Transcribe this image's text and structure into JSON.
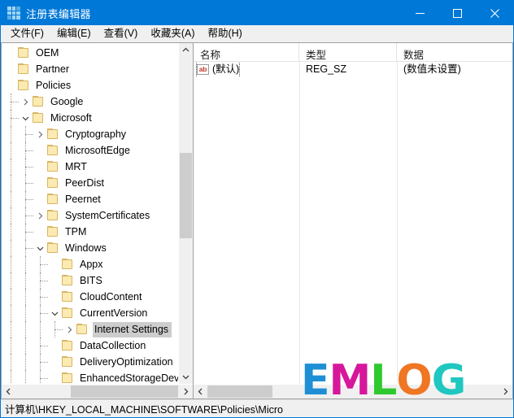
{
  "window": {
    "title": "注册表编辑器",
    "icon": "registry-grid-icon",
    "accent_color": "#0078d7",
    "controls": {
      "minimize": "最小化",
      "maximize": "最大化",
      "close": "关闭"
    }
  },
  "menu": {
    "items": [
      {
        "label": "文件(F)",
        "name": "menu-file"
      },
      {
        "label": "编辑(E)",
        "name": "menu-edit"
      },
      {
        "label": "查看(V)",
        "name": "menu-view"
      },
      {
        "label": "收藏夹(A)",
        "name": "menu-favorites"
      },
      {
        "label": "帮助(H)",
        "name": "menu-help"
      }
    ]
  },
  "tree": {
    "items": [
      {
        "label": "OEM",
        "depth": 0,
        "twisty": "none",
        "selected": false
      },
      {
        "label": "Partner",
        "depth": 0,
        "twisty": "none",
        "selected": false
      },
      {
        "label": "Policies",
        "depth": 0,
        "twisty": "none",
        "selected": false
      },
      {
        "label": "Google",
        "depth": 1,
        "twisty": "collapsed",
        "selected": false
      },
      {
        "label": "Microsoft",
        "depth": 1,
        "twisty": "expanded",
        "selected": false
      },
      {
        "label": "Cryptography",
        "depth": 2,
        "twisty": "collapsed",
        "selected": false
      },
      {
        "label": "MicrosoftEdge",
        "depth": 2,
        "twisty": "none",
        "selected": false
      },
      {
        "label": "MRT",
        "depth": 2,
        "twisty": "none",
        "selected": false
      },
      {
        "label": "PeerDist",
        "depth": 2,
        "twisty": "none",
        "selected": false
      },
      {
        "label": "Peernet",
        "depth": 2,
        "twisty": "none",
        "selected": false
      },
      {
        "label": "SystemCertificates",
        "depth": 2,
        "twisty": "collapsed",
        "selected": false
      },
      {
        "label": "TPM",
        "depth": 2,
        "twisty": "none",
        "selected": false
      },
      {
        "label": "Windows",
        "depth": 2,
        "twisty": "expanded",
        "selected": false
      },
      {
        "label": "Appx",
        "depth": 3,
        "twisty": "none",
        "selected": false
      },
      {
        "label": "BITS",
        "depth": 3,
        "twisty": "none",
        "selected": false
      },
      {
        "label": "CloudContent",
        "depth": 3,
        "twisty": "none",
        "selected": false
      },
      {
        "label": "CurrentVersion",
        "depth": 3,
        "twisty": "expanded",
        "selected": false
      },
      {
        "label": "Internet Settings",
        "depth": 4,
        "twisty": "collapsed",
        "selected": true
      },
      {
        "label": "DataCollection",
        "depth": 3,
        "twisty": "none",
        "selected": false
      },
      {
        "label": "DeliveryOptimization",
        "depth": 3,
        "twisty": "none",
        "selected": false
      },
      {
        "label": "EnhancedStorageDevic",
        "depth": 3,
        "twisty": "none",
        "selected": false
      }
    ]
  },
  "list": {
    "columns": [
      {
        "label": "名称",
        "name": "column-name"
      },
      {
        "label": "类型",
        "name": "column-type"
      },
      {
        "label": "数据",
        "name": "column-data"
      }
    ],
    "rows": [
      {
        "icon": "string-value-icon",
        "icon_text": "ab",
        "name": "(默认)",
        "type": "REG_SZ",
        "data": "(数值未设置)"
      }
    ]
  },
  "status": {
    "path": "计算机\\HKEY_LOCAL_MACHINE\\SOFTWARE\\Policies\\Micro"
  },
  "watermark": {
    "letters": [
      {
        "char": "E",
        "color": "#1e8fd5"
      },
      {
        "char": "M",
        "color": "#d6179b"
      },
      {
        "char": "L",
        "color": "#2ec92e"
      },
      {
        "char": "O",
        "color": "#ef7622"
      },
      {
        "char": "G",
        "color": "#1fc7c0"
      }
    ]
  }
}
